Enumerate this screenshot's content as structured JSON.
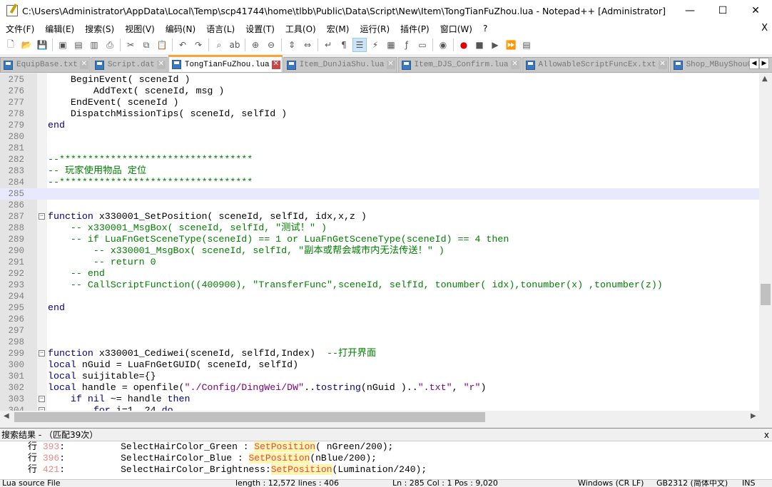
{
  "title": "C:\\Users\\Administrator\\AppData\\Local\\Temp\\scp41744\\home\\tlbb\\Public\\Data\\Script\\New\\Item\\TongTianFuZhou.lua - Notepad++ [Administrator]",
  "window_buttons": {
    "minimize": "—",
    "maximize": "☐",
    "close": "✕"
  },
  "menu": [
    "文件(F)",
    "编辑(E)",
    "搜索(S)",
    "视图(V)",
    "编码(N)",
    "语言(L)",
    "设置(T)",
    "工具(O)",
    "宏(M)",
    "运行(R)",
    "插件(P)",
    "窗口(W)",
    "?"
  ],
  "menu_close": "X",
  "toolbar": [
    "new-file",
    "open-file",
    "save",
    "save-all",
    "close",
    "close-all",
    "print",
    "cut",
    "copy",
    "paste",
    "undo",
    "redo",
    "find",
    "replace",
    "zoom-in",
    "zoom-out",
    "sync-v",
    "sync-h",
    "word-wrap",
    "show-all",
    "indent-guide",
    "udl",
    "doc-map",
    "function-list",
    "folder-workspace",
    "monitor",
    "record-macro",
    "stop-macro",
    "play-macro",
    "run-macro-multiple",
    "save-macro"
  ],
  "tabs": [
    {
      "label": "EquipBase.txt",
      "active": false
    },
    {
      "label": "Script.dat",
      "active": false
    },
    {
      "label": "TongTianFuZhou.lua",
      "active": true
    },
    {
      "label": "Item_DunJiaShu.lua",
      "active": false
    },
    {
      "label": "Item_DJS_Confirm.lua",
      "active": false
    },
    {
      "label": "AllowableScriptFuncEx.txt",
      "active": false
    },
    {
      "label": "Shop_MBuyShouGong.lua",
      "active": false
    }
  ],
  "current_line": 285,
  "lines": [
    {
      "n": 275,
      "t": [
        [
          "    BeginEvent( sceneId )",
          "pl"
        ]
      ]
    },
    {
      "n": 276,
      "t": [
        [
          "        AddText( sceneId, msg )",
          "pl"
        ]
      ]
    },
    {
      "n": 277,
      "t": [
        [
          "    EndEvent( sceneId )",
          "pl"
        ]
      ]
    },
    {
      "n": 278,
      "t": [
        [
          "    DispatchMissionTips( sceneId, selfId )",
          "pl"
        ]
      ]
    },
    {
      "n": 279,
      "t": [
        [
          "end",
          "kw"
        ]
      ]
    },
    {
      "n": 280,
      "t": []
    },
    {
      "n": 281,
      "t": []
    },
    {
      "n": 282,
      "t": [
        [
          "--**********************************",
          "cm"
        ]
      ]
    },
    {
      "n": 283,
      "t": [
        [
          "-- 玩家使用物品 定位",
          "cm"
        ]
      ]
    },
    {
      "n": 284,
      "t": [
        [
          "--**********************************",
          "cm"
        ]
      ]
    },
    {
      "n": 285,
      "t": []
    },
    {
      "n": 286,
      "t": []
    },
    {
      "n": 287,
      "fold": "-",
      "t": [
        [
          "function",
          "kw"
        ],
        [
          " x330001_SetPosition( sceneId, selfId, idx,x,z )",
          "pl"
        ]
      ]
    },
    {
      "n": 288,
      "t": [
        [
          "    -- x330001_MsgBox( sceneId, selfId, \"测试！\" )",
          "cm"
        ]
      ]
    },
    {
      "n": 289,
      "t": [
        [
          "    -- if LuaFnGetSceneType(sceneId) == 1 or LuaFnGetSceneType(sceneId) == 4 then",
          "cm"
        ]
      ]
    },
    {
      "n": 290,
      "t": [
        [
          "        -- x330001_MsgBox( sceneId, selfId, \"副本或帮会城市内无法传送！\" )",
          "cm"
        ]
      ]
    },
    {
      "n": 291,
      "t": [
        [
          "        -- return 0",
          "cm"
        ]
      ]
    },
    {
      "n": 292,
      "t": [
        [
          "    -- end",
          "cm"
        ]
      ]
    },
    {
      "n": 293,
      "t": [
        [
          "    -- CallScriptFunction((400900), \"TransferFunc\",sceneId, selfId, tonumber( idx),tonumber(x) ,tonumber(z))",
          "cm"
        ]
      ]
    },
    {
      "n": 294,
      "t": []
    },
    {
      "n": 295,
      "t": [
        [
          "end",
          "kw"
        ]
      ]
    },
    {
      "n": 296,
      "t": []
    },
    {
      "n": 297,
      "t": []
    },
    {
      "n": 298,
      "t": []
    },
    {
      "n": 299,
      "fold": "-",
      "t": [
        [
          "function",
          "kw"
        ],
        [
          " x330001_Cediwei(sceneId, selfId,Index)  ",
          "pl"
        ],
        [
          "--打开界面",
          "cm"
        ]
      ]
    },
    {
      "n": 300,
      "t": [
        [
          "local",
          "kw"
        ],
        [
          " nGuid = LuaFnGetGUID( sceneId, selfId)",
          "pl"
        ]
      ]
    },
    {
      "n": 301,
      "t": [
        [
          "local",
          "kw"
        ],
        [
          " suijitable={}",
          "pl"
        ]
      ]
    },
    {
      "n": 302,
      "t": [
        [
          "local",
          "kw"
        ],
        [
          " handle = openfile(",
          "pl"
        ],
        [
          "\"./Config/DingWei/DW\"",
          "str"
        ],
        [
          "..",
          "pl"
        ],
        [
          "tostring",
          "fn"
        ],
        [
          "(nGuid )..",
          "pl"
        ],
        [
          "\".txt\"",
          "str"
        ],
        [
          ", ",
          "pl"
        ],
        [
          "\"r\"",
          "str"
        ],
        [
          ")",
          "pl"
        ]
      ]
    },
    {
      "n": 303,
      "fold": "-",
      "t": [
        [
          "    if nil",
          "kw"
        ],
        [
          " ~= handle ",
          "pl"
        ],
        [
          "then",
          "kw"
        ]
      ]
    },
    {
      "n": 304,
      "fold": "-",
      "t": [
        [
          "        for",
          "kw"
        ],
        [
          " i=1, 24 ",
          "pl"
        ],
        [
          "do",
          "kw"
        ]
      ]
    }
  ],
  "search": {
    "header": "搜索结果 - （匹配39次）",
    "close": "x",
    "results": [
      {
        "prefix": "行 ",
        "line": "393",
        "sep": ":          ",
        "before": "SelectHairColor_Green : ",
        "match": "SetPosition",
        "after": "( nGreen/200);"
      },
      {
        "prefix": "行 ",
        "line": "396",
        "sep": ":          ",
        "before": "SelectHairColor_Blue : ",
        "match": "SetPosition",
        "after": "(nBlue/200);"
      },
      {
        "prefix": "行 ",
        "line": "421",
        "sep": ":          ",
        "before": "SelectHairColor_Brightness:",
        "match": "SetPosition",
        "after": "(Lumination/240);"
      }
    ]
  },
  "status": {
    "type": "Lua source File",
    "length": "length : 12,572    lines : 406",
    "pos": "Ln : 285    Col : 1    Pos : 9,020",
    "eol": "Windows (CR LF)",
    "encoding": "GB2312 (简体中文)",
    "mode": "INS"
  }
}
